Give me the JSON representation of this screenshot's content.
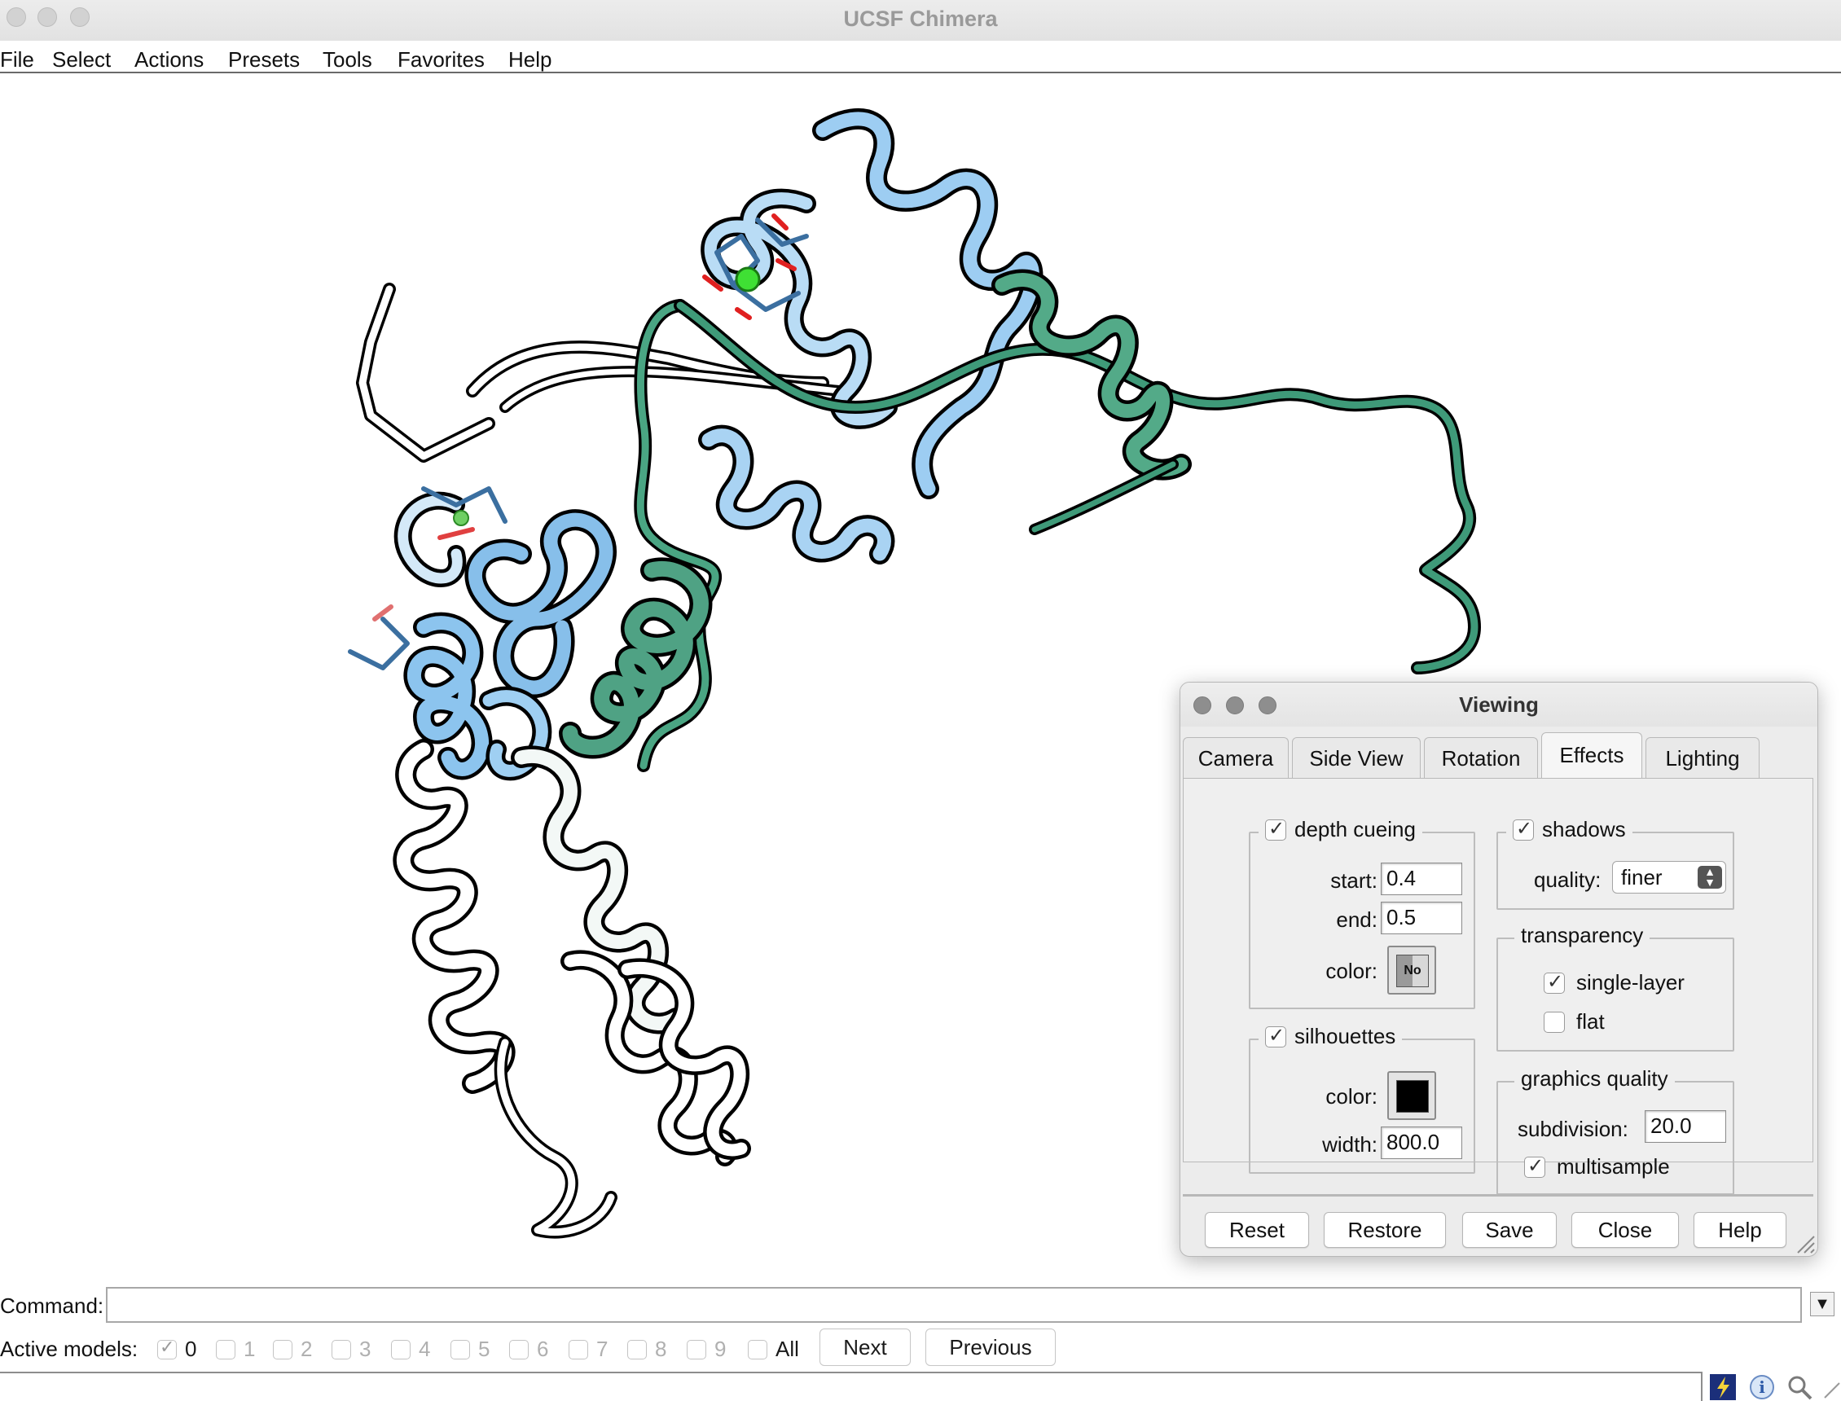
{
  "window": {
    "title": "UCSF Chimera"
  },
  "menubar": [
    "File",
    "Select",
    "Actions",
    "Presets",
    "Tools",
    "Favorites",
    "Help"
  ],
  "viewing_dialog": {
    "title": "Viewing",
    "tabs": [
      "Camera",
      "Side View",
      "Rotation",
      "Effects",
      "Lighting"
    ],
    "active_tab": "Effects",
    "depth_cueing": {
      "label": "depth cueing",
      "checked": true,
      "start_label": "start:",
      "start": "0.4",
      "end_label": "end:",
      "end": "0.5",
      "color_label": "color:",
      "color_text": "No"
    },
    "silhouettes": {
      "label": "silhouettes",
      "checked": true,
      "color_label": "color:",
      "color": "#000000",
      "width_label": "width:",
      "width": "800.0"
    },
    "shadows": {
      "label": "shadows",
      "checked": true,
      "quality_label": "quality:",
      "quality": "finer"
    },
    "transparency": {
      "label": "transparency",
      "single_layer": {
        "label": "single-layer",
        "checked": true
      },
      "flat": {
        "label": "flat",
        "checked": false
      }
    },
    "graphics_quality": {
      "label": "graphics quality",
      "subdivision_label": "subdivision:",
      "subdivision": "20.0",
      "multisample": {
        "label": "multisample",
        "checked": true
      }
    },
    "buttons": [
      "Reset",
      "Restore",
      "Save",
      "Close",
      "Help"
    ]
  },
  "command": {
    "label": "Command:",
    "value": ""
  },
  "active_models": {
    "label": "Active models:",
    "models": [
      {
        "label": "0",
        "checked": true,
        "enabled": true
      },
      {
        "label": "1",
        "checked": false,
        "enabled": false
      },
      {
        "label": "2",
        "checked": false,
        "enabled": false
      },
      {
        "label": "3",
        "checked": false,
        "enabled": false
      },
      {
        "label": "4",
        "checked": false,
        "enabled": false
      },
      {
        "label": "5",
        "checked": false,
        "enabled": false
      },
      {
        "label": "6",
        "checked": false,
        "enabled": false
      },
      {
        "label": "7",
        "checked": false,
        "enabled": false
      },
      {
        "label": "8",
        "checked": false,
        "enabled": false
      },
      {
        "label": "9",
        "checked": false,
        "enabled": false
      }
    ],
    "all_label": "All",
    "next_label": "Next",
    "previous_label": "Previous"
  },
  "colors": {
    "helix_light_blue": "#8ec3ee",
    "helix_green": "#3d9a78",
    "ion_green": "#3fe034",
    "outline": "#000000"
  },
  "icons": [
    "lightning-icon",
    "info-icon",
    "magnifier-icon"
  ]
}
